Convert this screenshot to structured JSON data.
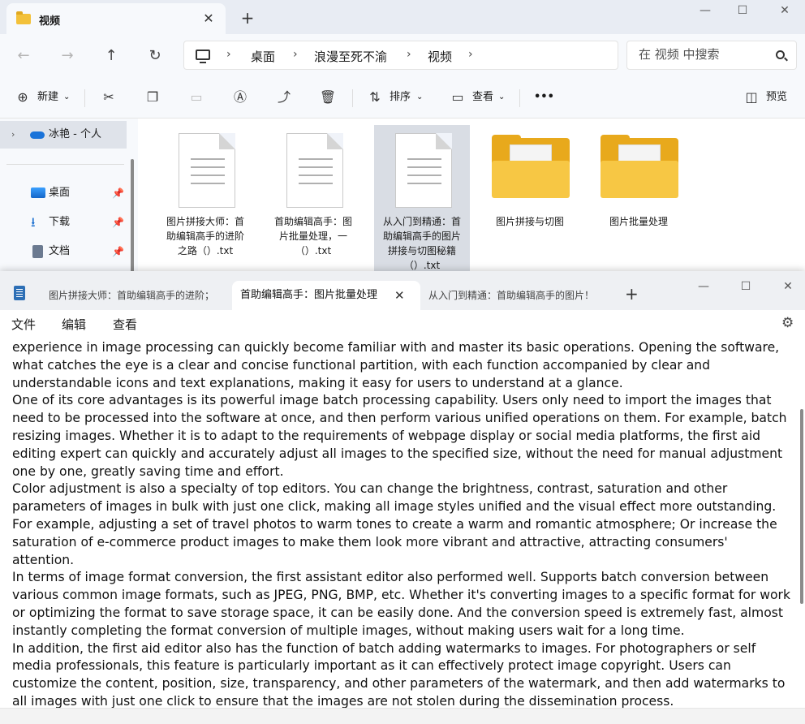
{
  "explorer": {
    "tab_title": "视频",
    "breadcrumbs": [
      "桌面",
      "浪漫至死不渝",
      "视频"
    ],
    "search_placeholder": "在 视频 中搜索",
    "toolbar": {
      "new_label": "新建",
      "sort_label": "排序",
      "view_label": "查看",
      "more_label": "•••",
      "preview_label": "预览"
    },
    "nav": {
      "cloud": "冰艳 - 个人",
      "items": [
        {
          "label": "桌面"
        },
        {
          "label": "下载"
        },
        {
          "label": "文档"
        }
      ]
    },
    "files": [
      {
        "name": "图片拼接大师：首助编辑高手的进阶之路（）.txt",
        "type": "txt"
      },
      {
        "name": "首助编辑高手：图片批量处理，一（）.txt",
        "type": "txt"
      },
      {
        "name": "从入门到精通：首助编辑高手的图片拼接与切图秘籍（）.txt",
        "type": "txt"
      },
      {
        "name": "图片拼接与切图",
        "type": "folder"
      },
      {
        "name": "图片批量处理",
        "type": "folder"
      }
    ]
  },
  "notepad": {
    "tabs": [
      {
        "label": "图片拼接大师：首助编辑高手的进阶；"
      },
      {
        "label": "首助编辑高手：图片批量处理"
      },
      {
        "label": "从入门到精通：首助编辑高手的图片！"
      }
    ],
    "menu": [
      "文件",
      "编辑",
      "查看"
    ],
    "text": "experience in image processing can quickly become familiar with and master its basic operations. Opening the software, what catches the eye is a clear and concise functional partition, with each function accompanied by clear and understandable icons and text explanations, making it easy for users to understand at a glance.\nOne of its core advantages is its powerful image batch processing capability. Users only need to import the images that need to be processed into the software at once, and then perform various unified operations on them. For example, batch resizing images. Whether it is to adapt to the requirements of webpage display or social media platforms, the first aid editing expert can quickly and accurately adjust all images to the specified size, without the need for manual adjustment one by one, greatly saving time and effort.\nColor adjustment is also a specialty of top editors. You can change the brightness, contrast, saturation and other parameters of images in bulk with just one click, making all image styles unified and the visual effect more outstanding. For example, adjusting a set of travel photos to warm tones to create a warm and romantic atmosphere; Or increase the saturation of e-commerce product images to make them look more vibrant and attractive, attracting consumers' attention.\nIn terms of image format conversion, the first assistant editor also performed well. Supports batch conversion between various common image formats, such as JPEG, PNG, BMP, etc. Whether it's converting images to a specific format for work or optimizing the format to save storage space, it can be easily done. And the conversion speed is extremely fast, almost instantly completing the format conversion of multiple images, without making users wait for a long time.\nIn addition, the first aid editor also has the function of batch adding watermarks to images. For photographers or self media professionals, this feature is particularly important as it can effectively protect image copyright. Users can customize the content, position, size, transparency, and other parameters of the watermark, and then add watermarks to all images with just one click to ensure that the images are not stolen during the dissemination process.\nIn addition to the basic image batch processing functions mentioned above, the first aid editor also constantly updates"
  }
}
